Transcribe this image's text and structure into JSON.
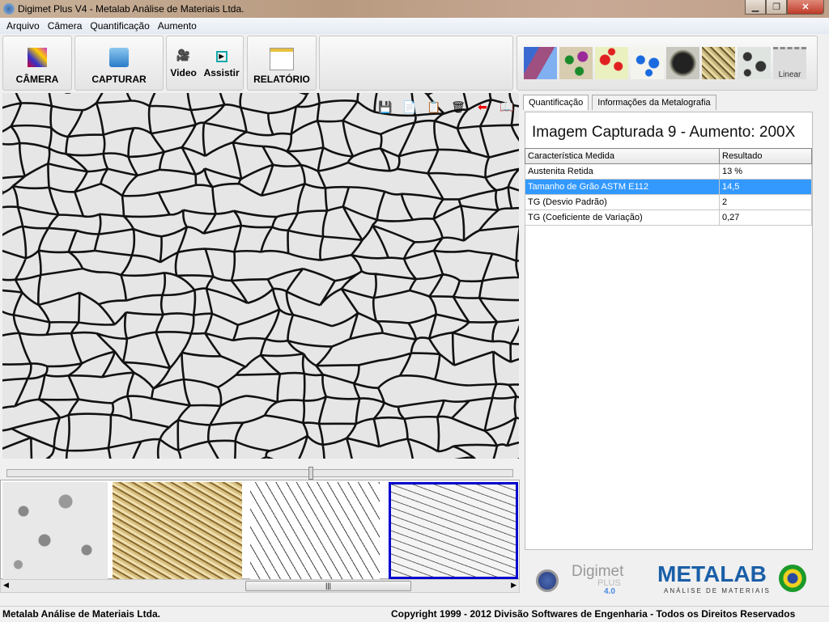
{
  "window": {
    "title": "Digimet Plus V4 - Metalab Análise de Materiais  Ltda."
  },
  "menu": [
    "Arquivo",
    "Câmera",
    "Quantificação",
    "Aumento"
  ],
  "toolbar": {
    "camera": "CÂMERA",
    "capture": "CAPTURAR",
    "video": "Video",
    "watch": "Assistir",
    "report": "RELATÓRIO",
    "linear": "Linear"
  },
  "viewer": {
    "icons": [
      "save-icon",
      "copy-icon",
      "paste-icon",
      "trash-icon",
      "back-arrow-icon",
      "book-icon"
    ]
  },
  "slider": {
    "value_percent": 60
  },
  "tabs": [
    "Quantificação",
    "Informações da Metalografia"
  ],
  "panel": {
    "heading": "Imagem Capturada 9 - Aumento: 200X",
    "columns": [
      "Característica Medida",
      "Resultado"
    ],
    "rows": [
      [
        "Austenita Retida",
        "13 %"
      ],
      [
        "Tamanho de Grão ASTM E112",
        "14,5"
      ],
      [
        "TG (Desvio Padrão)",
        "2"
      ],
      [
        "TG (Coeficiente de Variação)",
        "0,27"
      ]
    ],
    "selected_row": 1
  },
  "logos": {
    "digimet": "Digimet",
    "plus": "PLUS",
    "version": "4.0",
    "metalab": "METALAB",
    "metalab_sub": "ANÁLISE DE MATERIAIS"
  },
  "status": {
    "left": "Metalab Análise de Materiais Ltda.",
    "right": "Copyright  1999 - 2012  Divisão Softwares de Engenharia - Todos os Direitos Reservados"
  },
  "colors": {
    "selection": "#3399ff",
    "thumb_selected_border": "#0000cc",
    "metalab_blue": "#1a5fa8"
  }
}
